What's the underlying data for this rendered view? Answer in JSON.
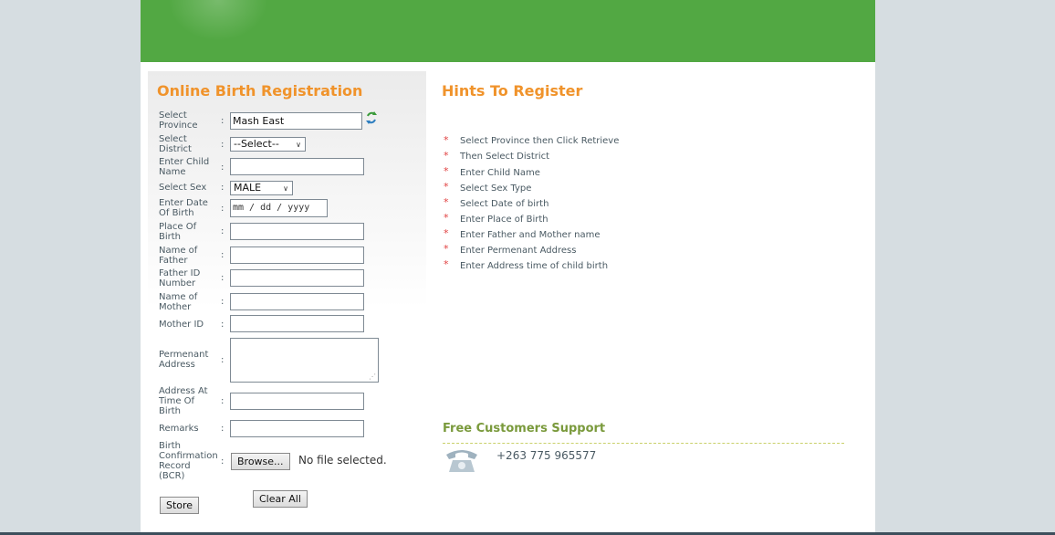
{
  "form": {
    "title": "Online Birth Registration",
    "fields": {
      "province": {
        "label": "Select Province",
        "value": "Mash East"
      },
      "district": {
        "label": "Select District",
        "value": "--Select--"
      },
      "child_name": {
        "label": "Enter Child Name",
        "value": ""
      },
      "sex": {
        "label": "Select Sex",
        "value": "MALE"
      },
      "dob": {
        "label": "Enter Date Of Birth",
        "placeholder": "mm / dd / yyyy"
      },
      "place_of_birth": {
        "label": "Place Of Birth",
        "value": ""
      },
      "father_name": {
        "label": "Name of Father",
        "value": ""
      },
      "father_id": {
        "label": "Father ID Number",
        "value": ""
      },
      "mother_name": {
        "label": "Name of Mother",
        "value": ""
      },
      "mother_id": {
        "label": "Mother ID",
        "value": ""
      },
      "permanent_address": {
        "label": "Permenant Address",
        "value": ""
      },
      "address_at_birth": {
        "label": "Address At Time Of Birth",
        "value": ""
      },
      "remarks": {
        "label": "Remarks",
        "value": ""
      },
      "bcr": {
        "label": "Birth Confirmation Record (BCR)",
        "browse_label": "Browse...",
        "file_status": "No file selected."
      }
    },
    "store_label": "Store",
    "clear_label": "Clear All",
    "colon": ":"
  },
  "hints": {
    "title": "Hints To Register",
    "marker": "*",
    "items": [
      "Select Province then Click Retrieve",
      "Then Select District",
      "Enter Child Name",
      "Select Sex Type",
      "Select Date of birth",
      "Enter Place of Birth",
      "Enter Father and Mother name",
      "Enter Permenant Address",
      "Enter Address time of child birth"
    ]
  },
  "support": {
    "title": "Free Customers Support",
    "phone": "+263 775 965577"
  },
  "icons": {
    "retrieve": "refresh-arrows-icon",
    "phone": "telephone-icon"
  },
  "colors": {
    "banner": "#52a843",
    "title_accent": "#f0932b",
    "support_accent": "#7a9a3c",
    "hint_marker": "#e04040"
  }
}
